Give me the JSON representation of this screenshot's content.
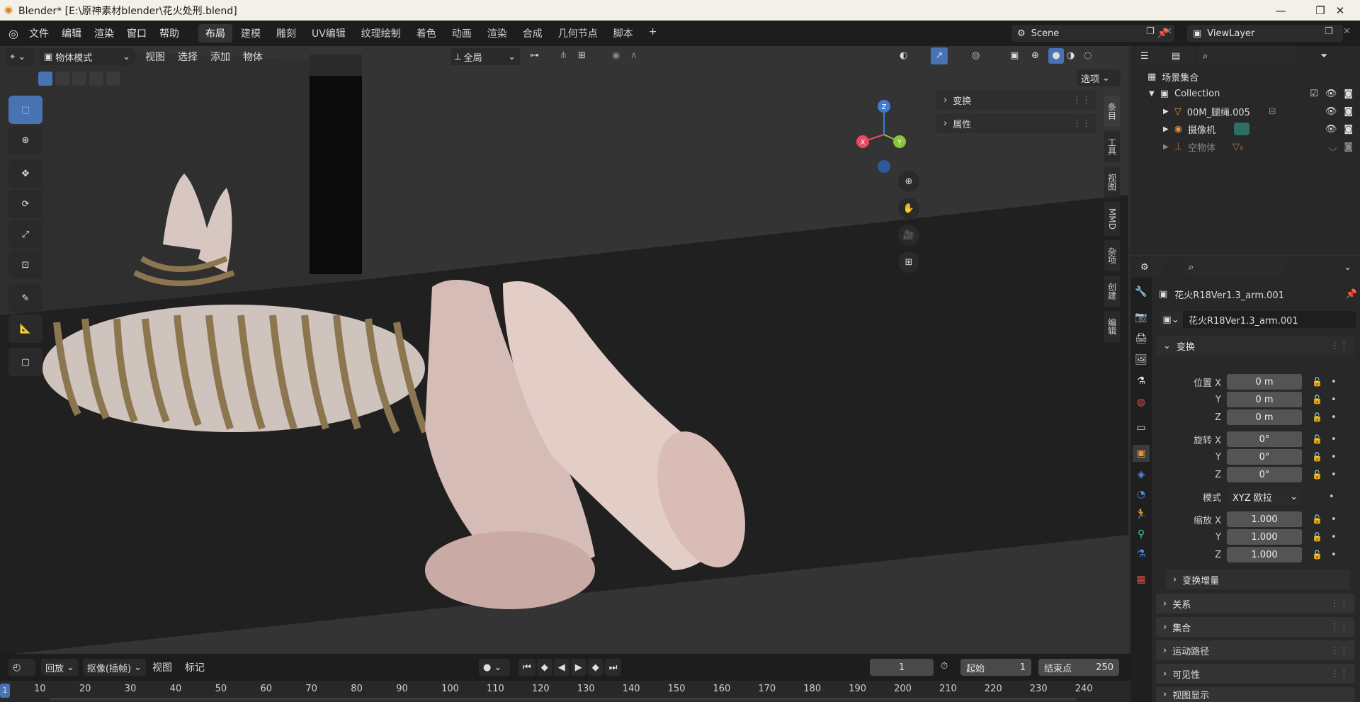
{
  "window": {
    "title": "Blender* [E:\\原神素材blender\\花火处刑.blend]"
  },
  "menus": [
    "文件",
    "编辑",
    "渲染",
    "窗口",
    "帮助"
  ],
  "workspaces": [
    "布局",
    "建模",
    "雕刻",
    "UV编辑",
    "纹理绘制",
    "着色",
    "动画",
    "渲染",
    "合成",
    "几何节点",
    "脚本"
  ],
  "active_workspace": "布局",
  "scene": {
    "name": "Scene",
    "view_layer": "ViewLayer"
  },
  "viewport": {
    "mode": "物体模式",
    "menus": [
      "视图",
      "选择",
      "添加",
      "物体"
    ],
    "transform_orientation": "全局",
    "options_label": "选项",
    "npanel": {
      "items": [
        "变换",
        "属性"
      ],
      "tabs": [
        "条目",
        "工具",
        "视图",
        "MMD",
        "杂项",
        "创建",
        "编辑"
      ]
    },
    "gizmo": {
      "x": "X",
      "y": "Y",
      "z": "Z"
    }
  },
  "outliner": {
    "root": "场景集合",
    "collection": "Collection",
    "items": [
      {
        "name": "00M_腿绳.005",
        "dim": false
      },
      {
        "name": "摄像机",
        "dim": false
      },
      {
        "name": "空物体",
        "dim": true
      }
    ]
  },
  "properties": {
    "object_name": "花火R18Ver1.3_arm.001",
    "data_name": "花火R18Ver1.3_arm.001",
    "transform_title": "变换",
    "location": {
      "label": "位置 X",
      "x": "0 m",
      "y": "0 m",
      "z": "0 m"
    },
    "rotation": {
      "label": "旋转 X",
      "x": "0°",
      "y": "0°",
      "z": "0°"
    },
    "mode_label": "模式",
    "mode_value": "XYZ 欧拉",
    "scale": {
      "label": "缩放 X",
      "x": "1.000",
      "y": "1.000",
      "z": "1.000"
    },
    "axis_y": "Y",
    "axis_z": "Z",
    "delta": "变换增量",
    "sections": [
      "关系",
      "集合",
      "运动路径",
      "可见性",
      "视图显示"
    ]
  },
  "timeline": {
    "menus": [
      "回放",
      "抠像(插帧)",
      "视图",
      "标记"
    ],
    "current_frame": "1",
    "start_label": "起始",
    "start": "1",
    "end_label": "结束点",
    "end": "250",
    "ticks": [
      "10",
      "20",
      "30",
      "40",
      "50",
      "60",
      "70",
      "80",
      "90",
      "100",
      "110",
      "120",
      "130",
      "140",
      "150",
      "160",
      "170",
      "180",
      "190",
      "200",
      "210",
      "220",
      "230",
      "240"
    ],
    "frame_marker": "1"
  }
}
